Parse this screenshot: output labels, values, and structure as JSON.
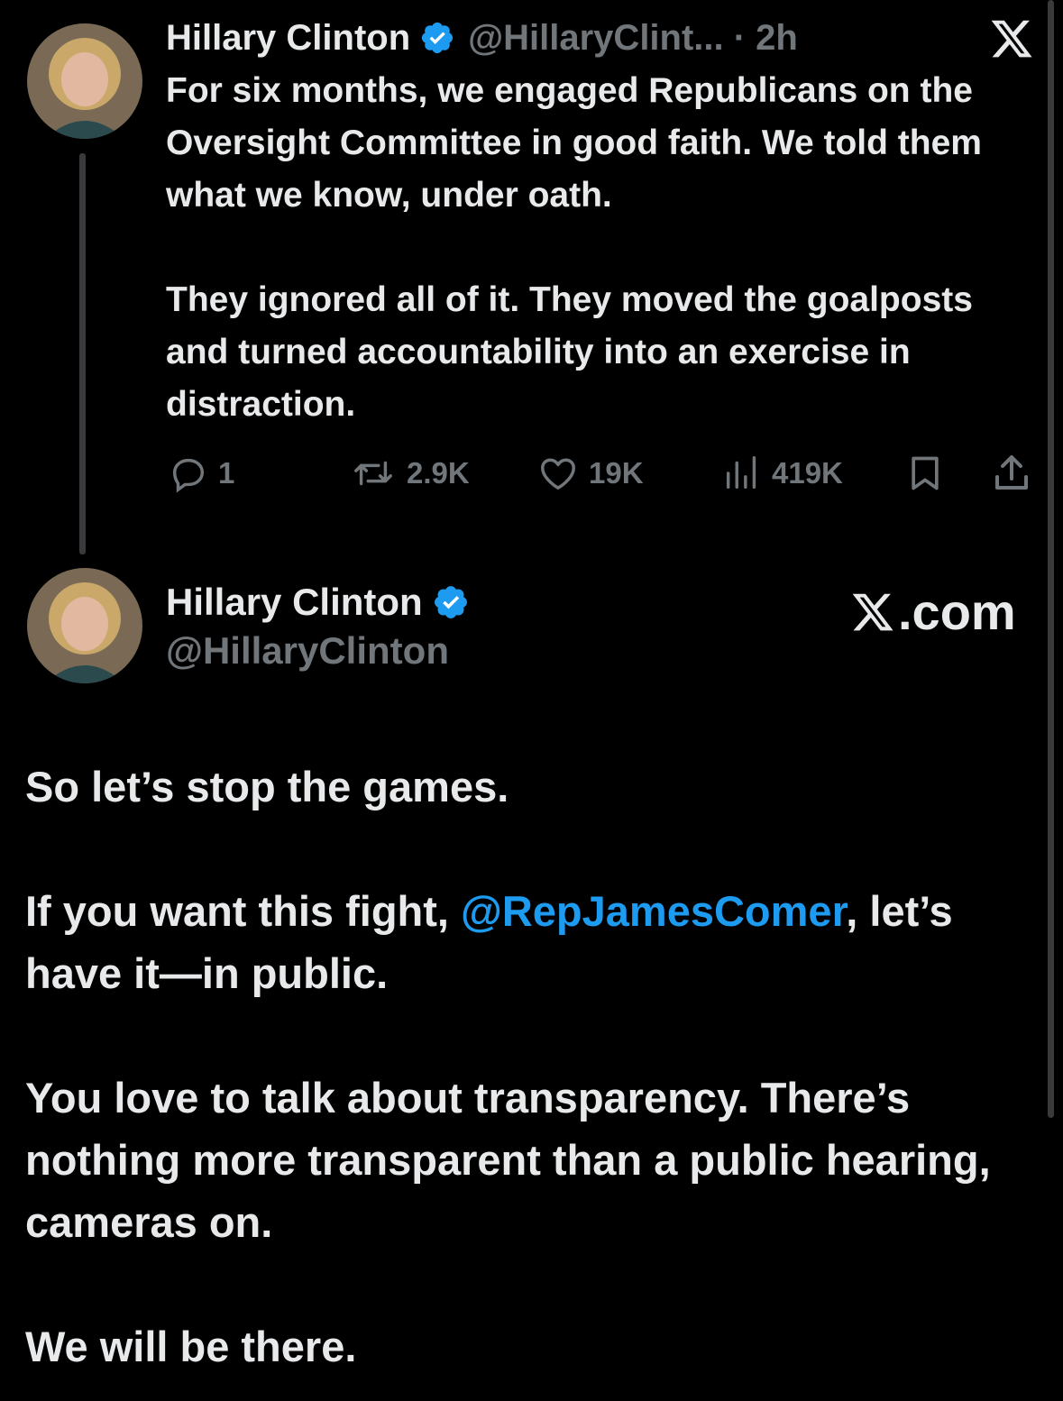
{
  "colors": {
    "background": "#000000",
    "text": "#e7e9ea",
    "muted": "#71767b",
    "accent": "#1d9bf0"
  },
  "tweet1": {
    "author": "Hillary Clinton",
    "handle_time": "@HillaryClint... · 2h",
    "verified_icon": "verified-badge-icon",
    "paragraphs": [
      "For six months, we engaged Republicans on the Oversight Committee in good faith. We told them what we know, under oath.",
      "They ignored all of it. They moved the goalposts and turned accountability into an exercise in distraction."
    ],
    "actions": {
      "replies": "1",
      "reposts": "2.9K",
      "likes": "19K",
      "views": "419K"
    }
  },
  "tweet2": {
    "author": "Hillary Clinton",
    "handle": "@HillaryClinton",
    "brand": ".com",
    "p1": "So let’s stop the games.",
    "p2_before": "If you want this fight, ",
    "p2_mention": "@RepJamesComer",
    "p2_after": ", let’s have it—in public.",
    "p3": "You love to talk about transparency. There’s nothing more transparent than a public hearing, cameras on.",
    "p4": "We will be there."
  }
}
